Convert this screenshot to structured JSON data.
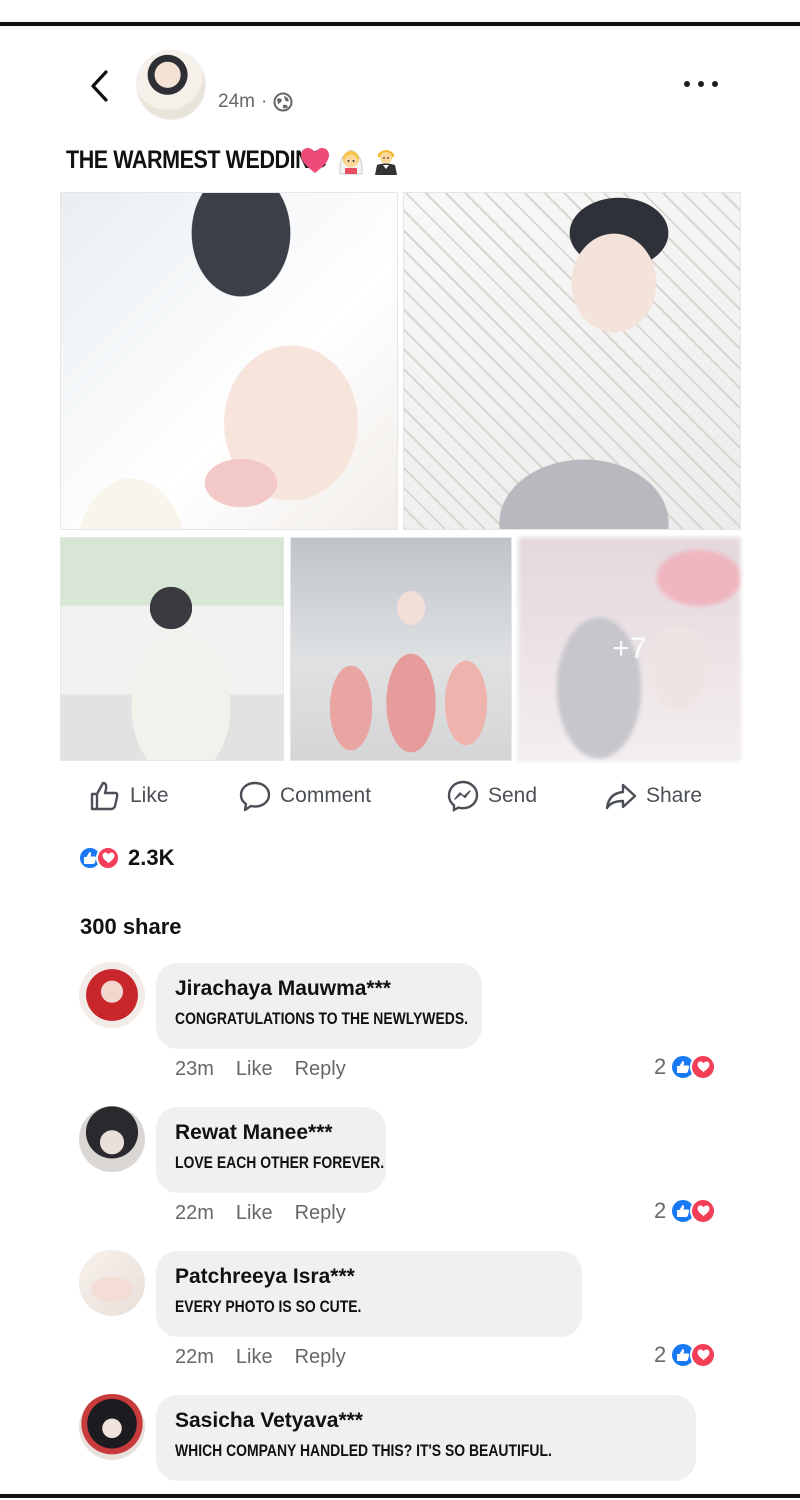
{
  "post": {
    "timestamp": "24m",
    "separator": "·",
    "title": "THE WARMEST WEDDING",
    "title_emojis": [
      "heart-emoji",
      "bride-emoji",
      "groom-emoji"
    ],
    "more_photos_label": "+7"
  },
  "actions": {
    "like": "Like",
    "comment": "Comment",
    "send": "Send",
    "share": "Share"
  },
  "reactions": {
    "count": "2.3K",
    "types": [
      "like",
      "love"
    ]
  },
  "shares": {
    "label": "300 share"
  },
  "comments": [
    {
      "name": "Jirachaya Mauwma***",
      "text": "CONGRATULATIONS TO THE NEWLYWEDS.",
      "time": "23m",
      "like_label": "Like",
      "reply_label": "Reply",
      "reaction_count": "2"
    },
    {
      "name": "Rewat Manee***",
      "text": "LOVE EACH OTHER FOREVER.",
      "time": "22m",
      "like_label": "Like",
      "reply_label": "Reply",
      "reaction_count": "2"
    },
    {
      "name": "Patchreeya Isra***",
      "text": "EVERY PHOTO IS SO CUTE.",
      "time": "22m",
      "like_label": "Like",
      "reply_label": "Reply",
      "reaction_count": "2"
    },
    {
      "name": "Sasicha Vetyava***",
      "text": "WHICH COMPANY HANDLED THIS? IT'S SO BEAUTIFUL."
    }
  ],
  "colors": {
    "like_blue": "#1877f2",
    "love_red": "#f33e58",
    "bubble_bg": "#eff0f2",
    "meta_gray": "#65676b"
  }
}
